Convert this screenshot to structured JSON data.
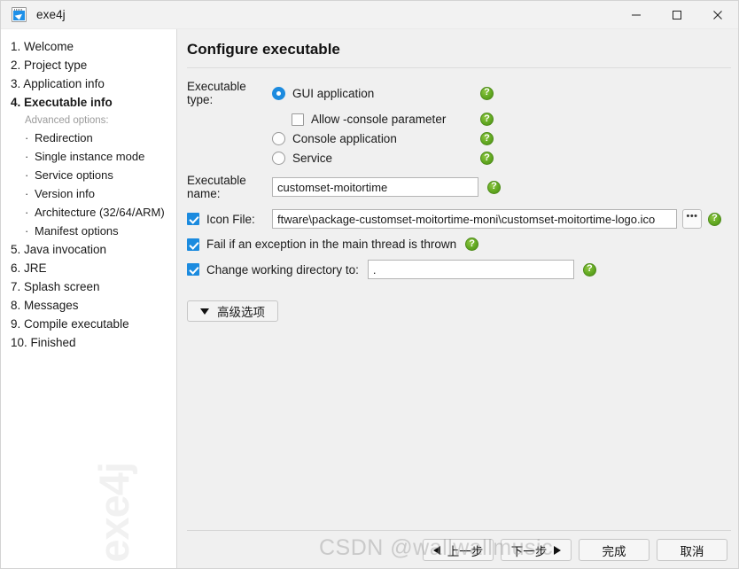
{
  "window": {
    "title": "exe4j",
    "app_icon": "exe4j-logo-icon",
    "controls": {
      "minimize": "minimize-icon",
      "maximize": "maximize-icon",
      "close": "close-icon"
    }
  },
  "sidebar": {
    "steps": [
      {
        "label": "1. Welcome",
        "active": false
      },
      {
        "label": "2. Project type",
        "active": false
      },
      {
        "label": "3. Application info",
        "active": false
      },
      {
        "label": "4. Executable info",
        "active": true
      }
    ],
    "advanced_header": "Advanced options:",
    "advanced_items": [
      "Redirection",
      "Single instance mode",
      "Service options",
      "Version info",
      "Architecture (32/64/ARM)",
      "Manifest options"
    ],
    "steps_after": [
      "5. Java invocation",
      "6. JRE",
      "7. Splash screen",
      "8. Messages",
      "9. Compile executable",
      "10. Finished"
    ],
    "watermark": "exe4j"
  },
  "main": {
    "page_title": "Configure executable",
    "executable_type": {
      "label": "Executable type:",
      "options": [
        {
          "label": "GUI application",
          "selected": true
        },
        {
          "label": "Console application",
          "selected": false
        },
        {
          "label": "Service",
          "selected": false
        }
      ],
      "allow_console": {
        "label": "Allow -console parameter",
        "checked": false
      }
    },
    "executable_name": {
      "label": "Executable name:",
      "value": "customset-moitortime"
    },
    "icon_file": {
      "label": "Icon File:",
      "checked": true,
      "value": "ftware\\package-customset-moitortime-moni\\customset-moitortime-logo.ico",
      "browse_label": "•••"
    },
    "fail_on_exception": {
      "label": "Fail if an exception in the main thread is thrown",
      "checked": true
    },
    "change_working_dir": {
      "label": "Change working directory to:",
      "checked": true,
      "value": "."
    },
    "advanced_button": {
      "label": "高级选项",
      "chevron": "chevron-down-icon"
    },
    "help_icon_label": "?"
  },
  "footer": {
    "buttons": [
      {
        "label": "上一步",
        "arrow": "left"
      },
      {
        "label": "下一步",
        "arrow": "right"
      },
      {
        "label": "完成",
        "arrow": "none"
      },
      {
        "label": "取消",
        "arrow": "none"
      }
    ],
    "watermark": "CSDN @wallwallmusic"
  },
  "colors": {
    "accent_blue": "#1c8bdf",
    "help_green": "#63a922",
    "panel_bg": "#f0f0f0",
    "sidebar_bg": "#ffffff"
  }
}
